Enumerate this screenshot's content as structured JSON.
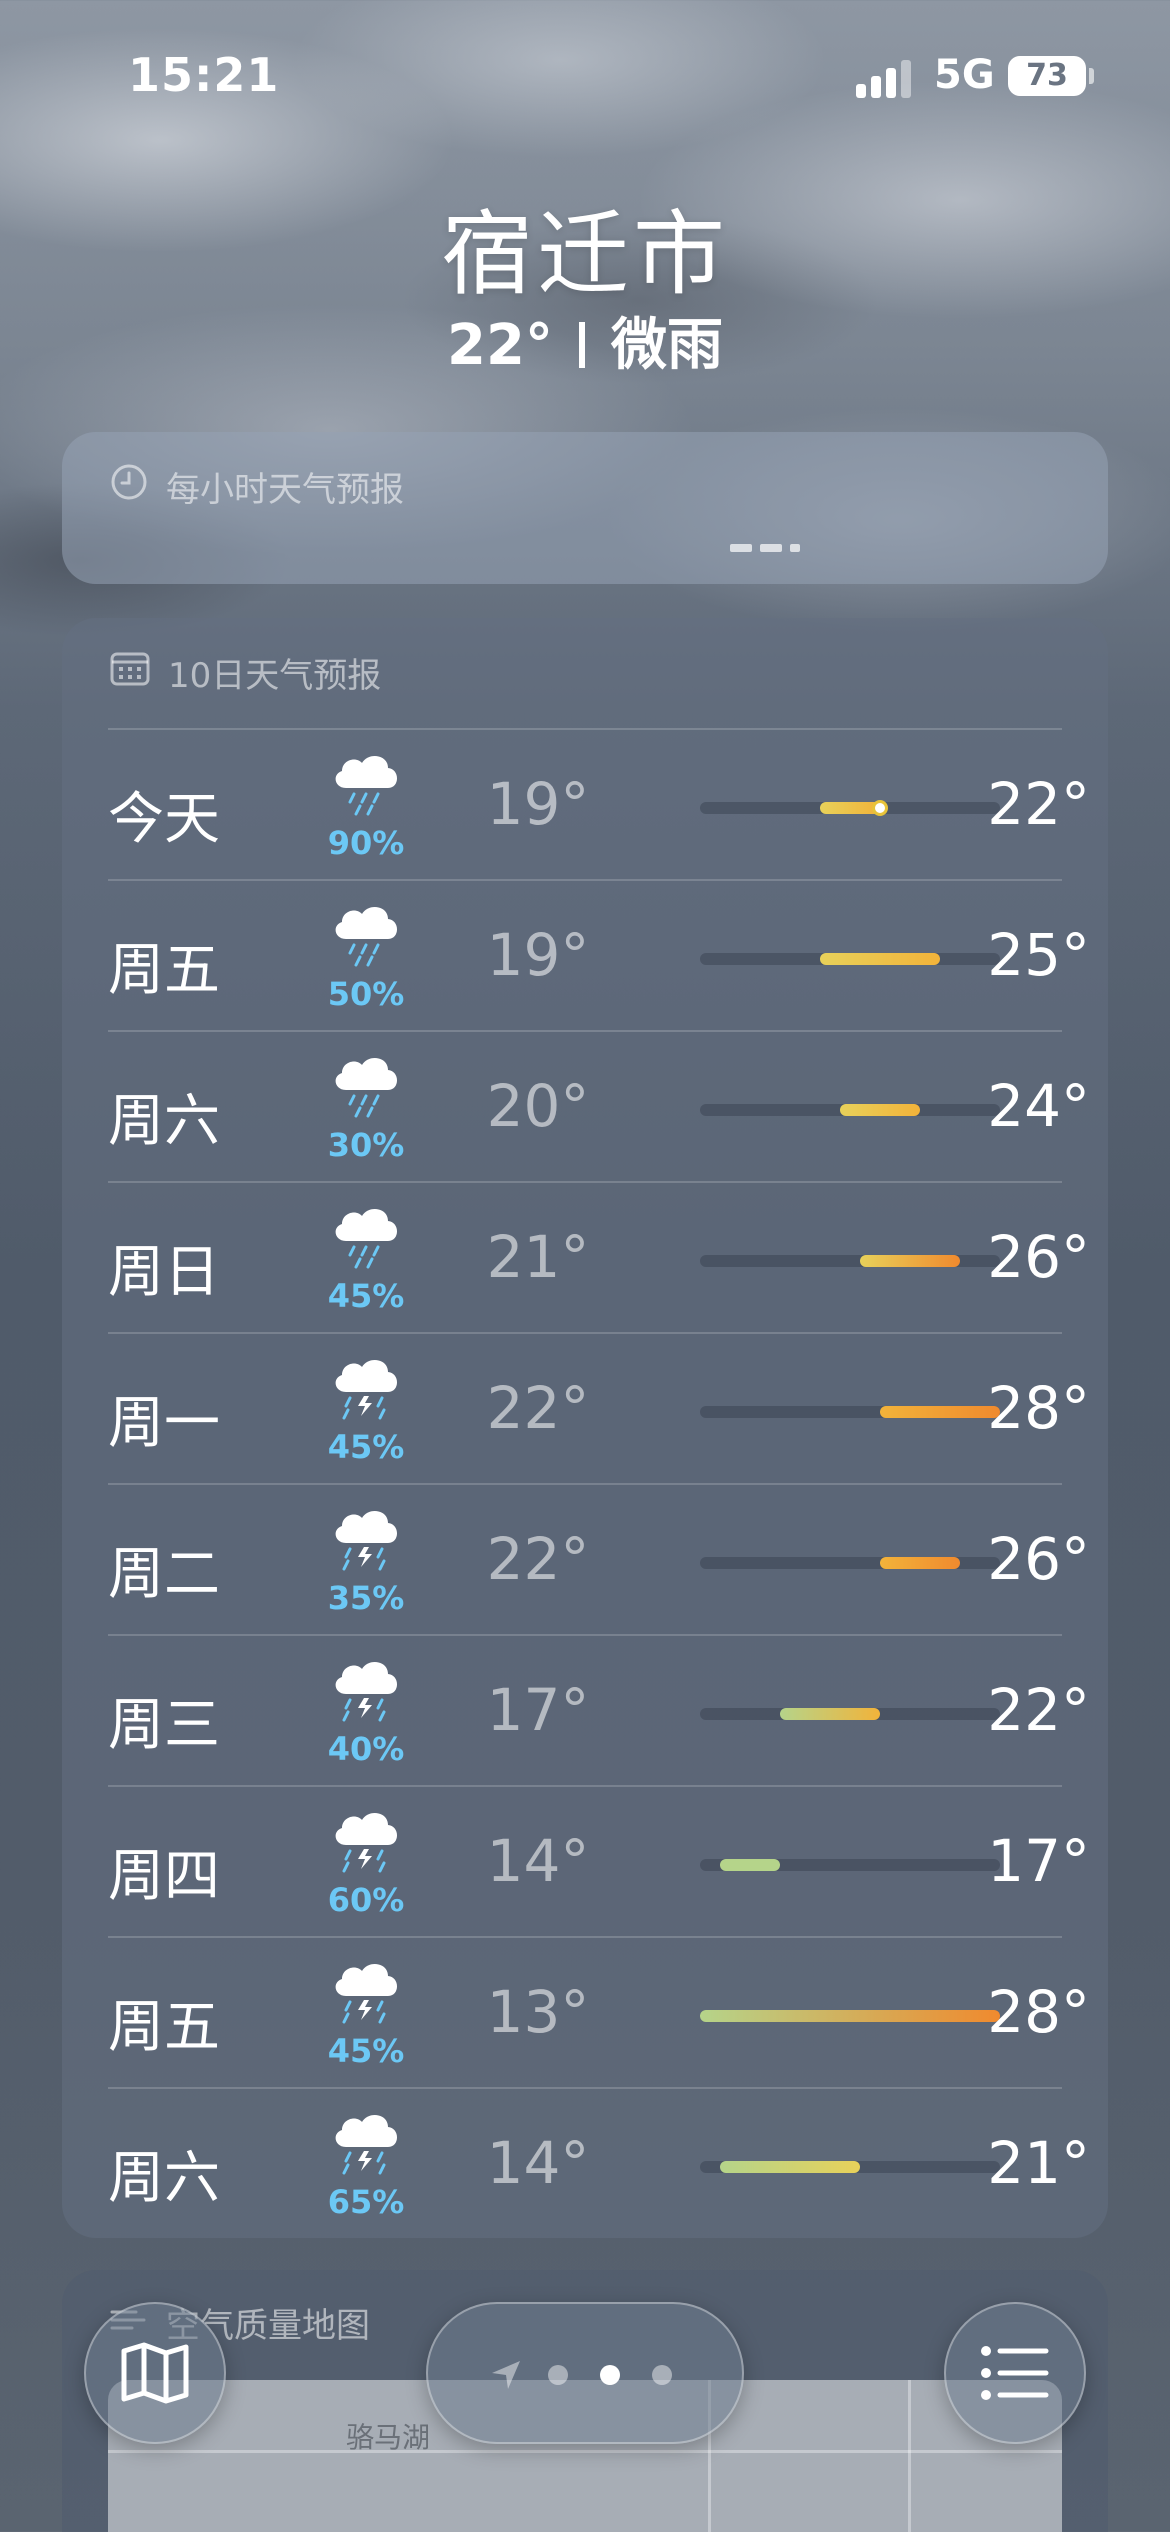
{
  "status_bar": {
    "time": "15:21",
    "network": "5G",
    "battery": "73"
  },
  "location": {
    "city": "宿迁市",
    "temperature": "22°",
    "condition": "微雨"
  },
  "hourly": {
    "title": "每小时天气预报",
    "icon": "clock-icon"
  },
  "ten_day": {
    "title": "10日天气预报",
    "icon": "calendar-icon",
    "range_min": 13,
    "range_max": 28,
    "current_temp": 22,
    "days": [
      {
        "day": "今天",
        "icon": "cloud-rain-icon",
        "precip": "90%",
        "low": "19°",
        "high": "22°",
        "low_v": 19,
        "high_v": 22,
        "is_today": true
      },
      {
        "day": "周五",
        "icon": "cloud-rain-icon",
        "precip": "50%",
        "low": "19°",
        "high": "25°",
        "low_v": 19,
        "high_v": 25
      },
      {
        "day": "周六",
        "icon": "cloud-rain-icon",
        "precip": "30%",
        "low": "20°",
        "high": "24°",
        "low_v": 20,
        "high_v": 24
      },
      {
        "day": "周日",
        "icon": "cloud-rain-icon",
        "precip": "45%",
        "low": "21°",
        "high": "26°",
        "low_v": 21,
        "high_v": 26
      },
      {
        "day": "周一",
        "icon": "cloud-thunderstorm-icon",
        "precip": "45%",
        "low": "22°",
        "high": "28°",
        "low_v": 22,
        "high_v": 28
      },
      {
        "day": "周二",
        "icon": "cloud-thunderstorm-icon",
        "precip": "35%",
        "low": "22°",
        "high": "26°",
        "low_v": 22,
        "high_v": 26
      },
      {
        "day": "周三",
        "icon": "cloud-thunderstorm-icon",
        "precip": "40%",
        "low": "17°",
        "high": "22°",
        "low_v": 17,
        "high_v": 22
      },
      {
        "day": "周四",
        "icon": "cloud-thunderstorm-icon",
        "precip": "60%",
        "low": "14°",
        "high": "17°",
        "low_v": 14,
        "high_v": 17
      },
      {
        "day": "周五",
        "icon": "cloud-thunderstorm-icon",
        "precip": "45%",
        "low": "13°",
        "high": "28°",
        "low_v": 13,
        "high_v": 28
      },
      {
        "day": "周六",
        "icon": "cloud-thunderstorm-icon",
        "precip": "65%",
        "low": "14°",
        "high": "21°",
        "low_v": 14,
        "high_v": 21
      }
    ]
  },
  "air_quality": {
    "title": "空气质量地图",
    "map_label": "骆马湖"
  },
  "toolbar": {
    "map_icon": "map-icon",
    "list_icon": "list-icon",
    "pages": 3,
    "active_page": 1
  },
  "colors": {
    "precip": "#6cc8f5",
    "cool": "#b5d48a",
    "mild": "#e8d15a",
    "warm": "#f2b33a",
    "hot": "#f08a2e"
  }
}
